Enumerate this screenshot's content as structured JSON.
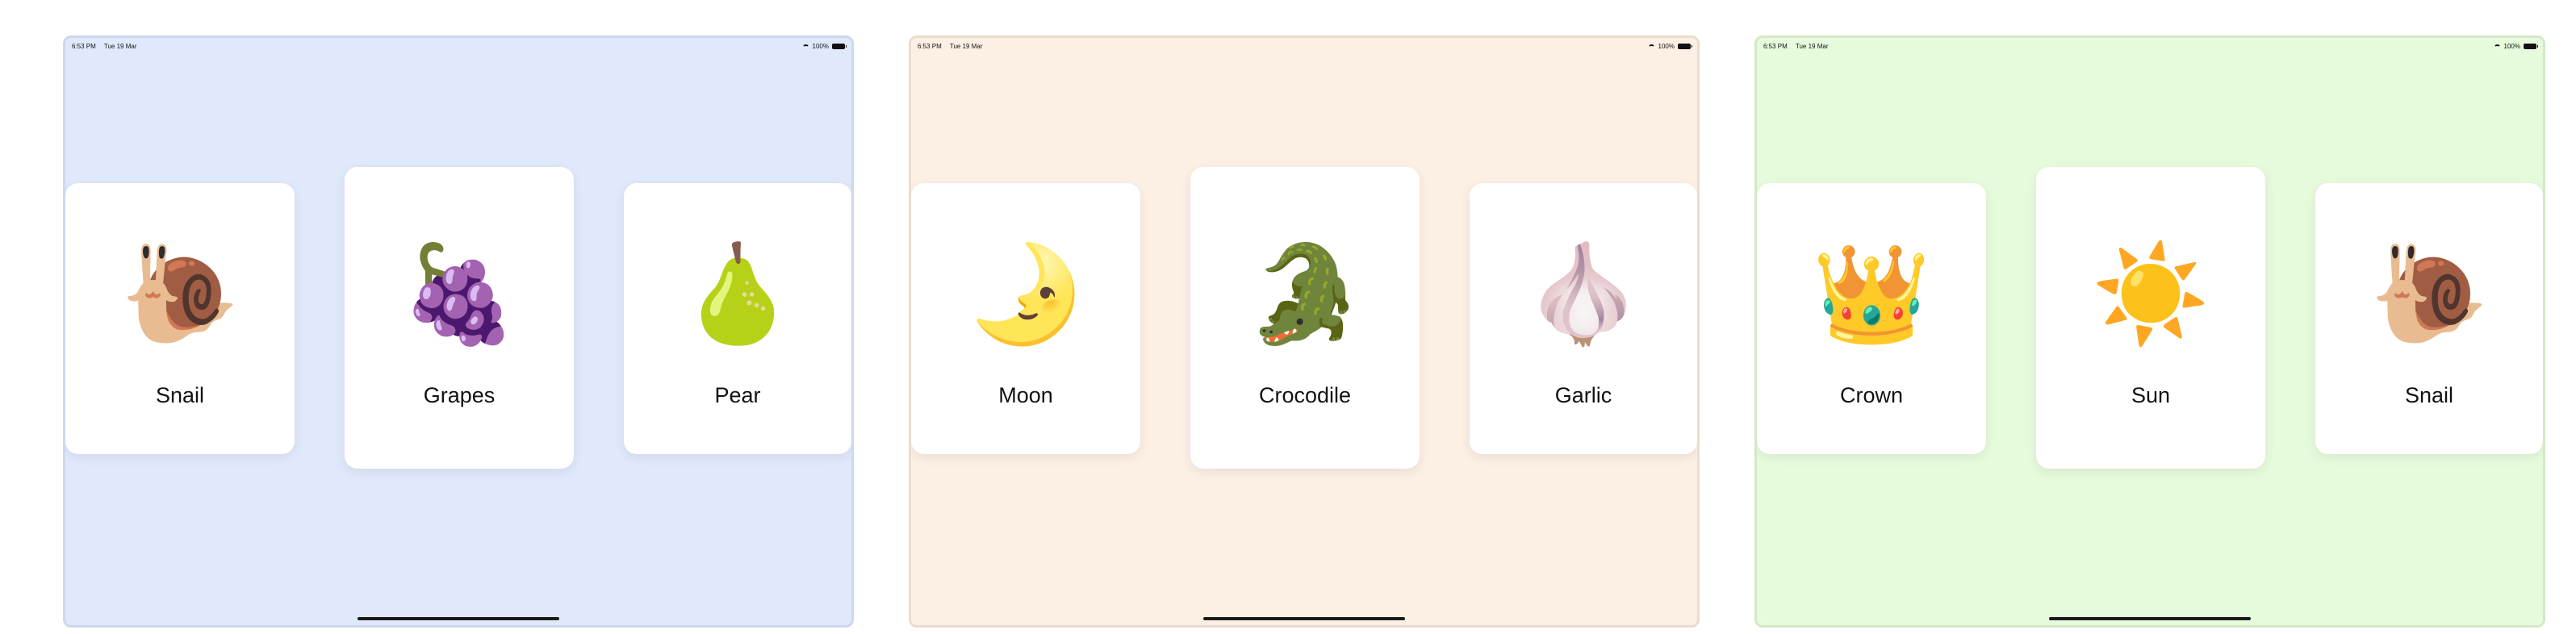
{
  "screens": [
    {
      "status_bar": {
        "time": "6:53 PM",
        "date": "Tue 19 Mar",
        "battery": "100%"
      },
      "cards": [
        {
          "emoji": "🐌",
          "label": "Snail"
        },
        {
          "emoji": "🍇",
          "label": "Grapes"
        },
        {
          "emoji": "🍐",
          "label": "Pear"
        }
      ],
      "background": "#e0e9fc"
    },
    {
      "status_bar": {
        "time": "6:53 PM",
        "date": "Tue 19 Mar",
        "battery": "100%"
      },
      "cards": [
        {
          "emoji": "🌛",
          "label": "Moon"
        },
        {
          "emoji": "🐊",
          "label": "Crocodile"
        },
        {
          "emoji": "🧄",
          "label": "Garlic"
        }
      ],
      "background": "#fcf0e4"
    },
    {
      "status_bar": {
        "time": "6:53 PM",
        "date": "Tue 19 Mar",
        "battery": "100%"
      },
      "cards": [
        {
          "emoji": "👑",
          "label": "Crown"
        },
        {
          "emoji": "☀️",
          "label": "Sun"
        },
        {
          "emoji": "🐌",
          "label": "Snail"
        }
      ],
      "background": "#e6fbdc"
    }
  ]
}
